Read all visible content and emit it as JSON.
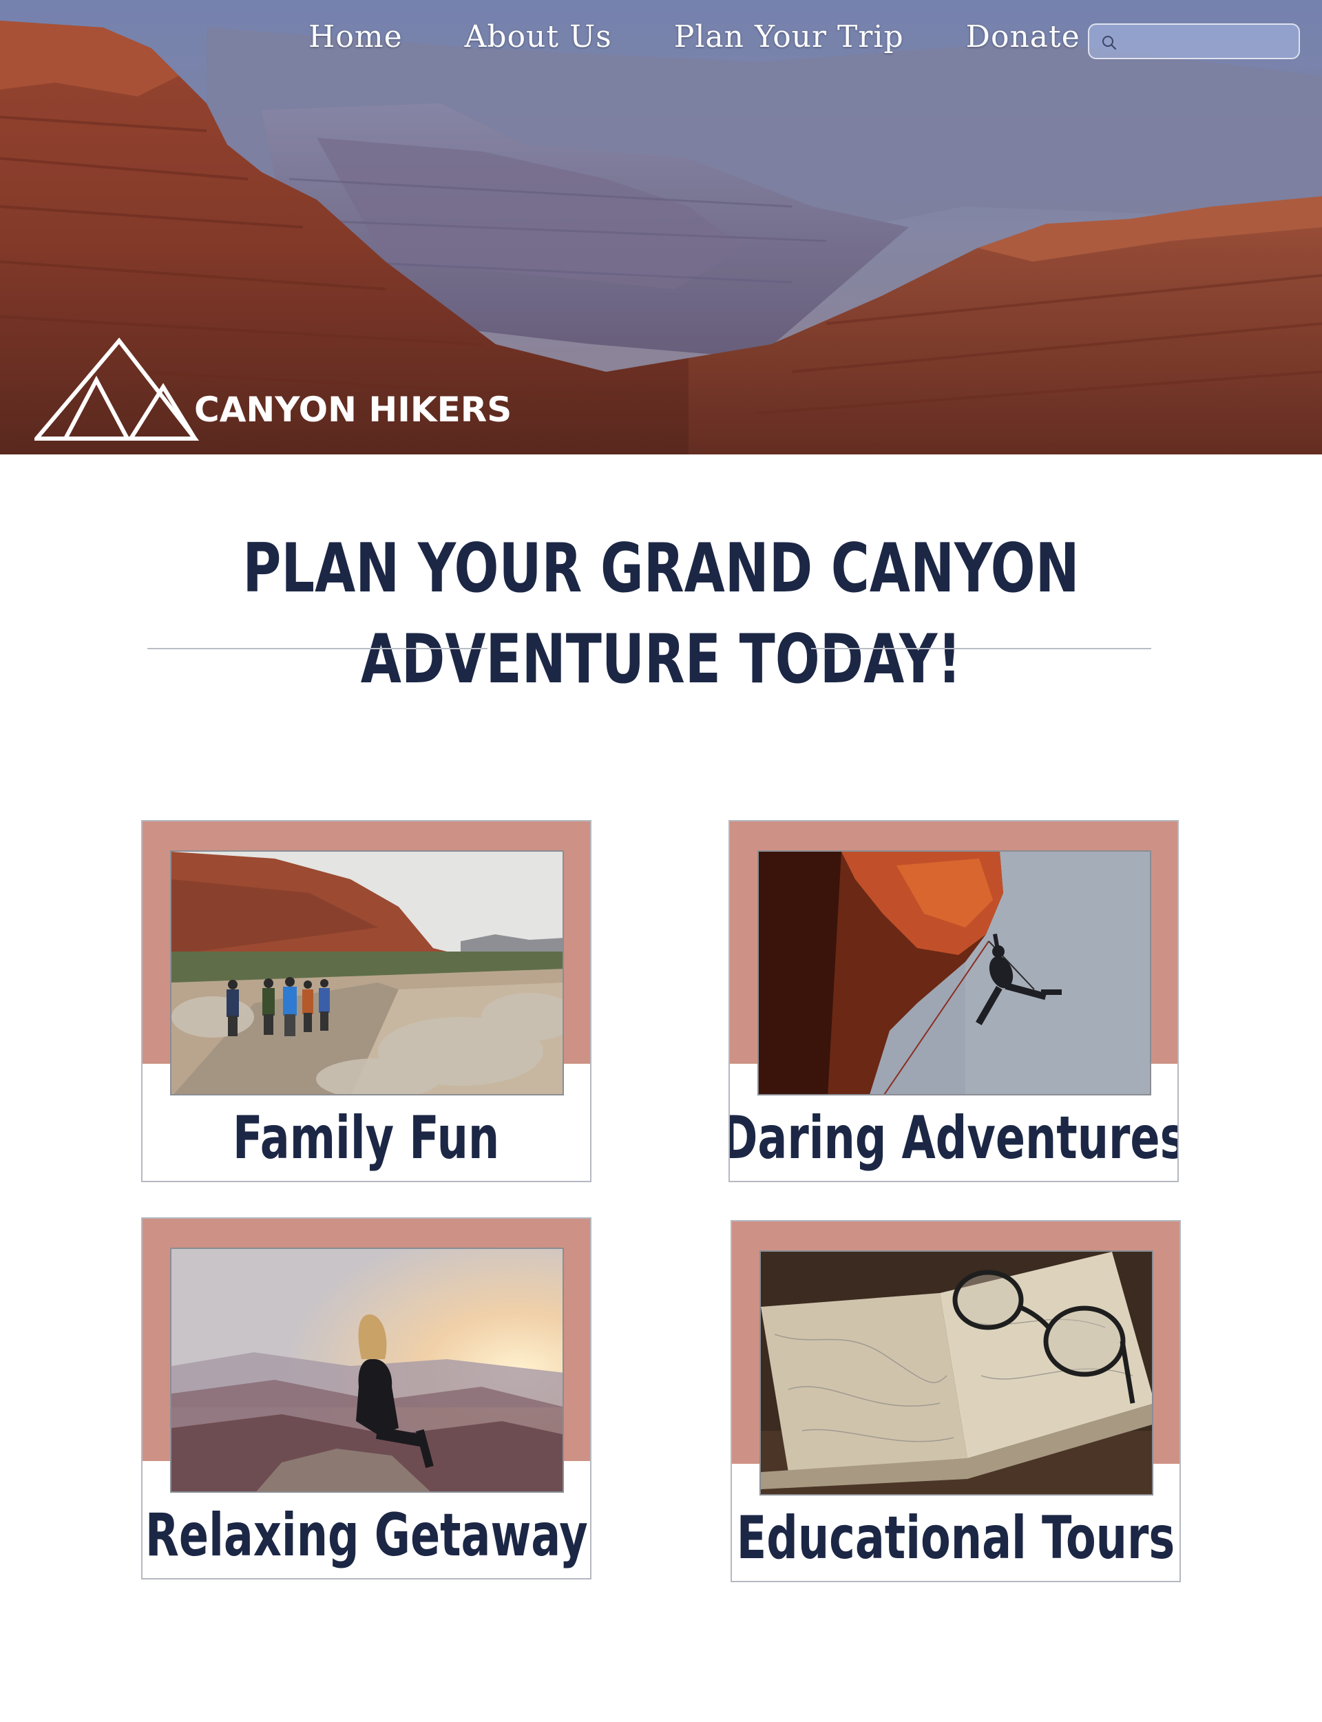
{
  "nav": {
    "items": [
      {
        "label": "Home"
      },
      {
        "label": "About Us"
      },
      {
        "label": "Plan Your Trip"
      },
      {
        "label": "Donate"
      }
    ],
    "search": {
      "placeholder": ""
    }
  },
  "brand": {
    "name": "CANYON HIKERS"
  },
  "main": {
    "heading": "PLAN YOUR GRAND CANYON ADVENTURE TODAY!",
    "cards": [
      {
        "title": "Family Fun"
      },
      {
        "title": "Daring Adventures"
      },
      {
        "title": "Relaxing Getaway"
      },
      {
        "title": "Educational Tours"
      }
    ]
  },
  "colors": {
    "heading": "#1c2745",
    "card_band": "#cd9285",
    "card_border": "#b5b8c0"
  },
  "icons": {
    "search": "search-icon",
    "logo": "mountain-logo-icon"
  }
}
